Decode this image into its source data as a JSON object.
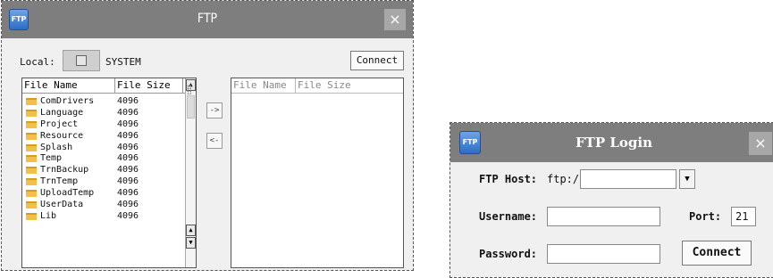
{
  "ftp_window": {
    "icon_text": "FTP",
    "title": "FTP",
    "close_glyph": "×",
    "local_label": "Local:",
    "local_path": "SYSTEM",
    "connect_label": "Connect",
    "copy_to_remote_label": "->",
    "copy_to_local_label": "<-",
    "local_list": {
      "columns": [
        "File Name",
        "File Size"
      ],
      "rows": [
        {
          "name": "ComDrivers",
          "size": "4096"
        },
        {
          "name": "Language",
          "size": "4096"
        },
        {
          "name": "Project",
          "size": "4096"
        },
        {
          "name": "Resource",
          "size": "4096"
        },
        {
          "name": "Splash",
          "size": "4096"
        },
        {
          "name": "Temp",
          "size": "4096"
        },
        {
          "name": "TrnBackup",
          "size": "4096"
        },
        {
          "name": "TrnTemp",
          "size": "4096"
        },
        {
          "name": "UploadTemp",
          "size": "4096"
        },
        {
          "name": "UserData",
          "size": "4096"
        },
        {
          "name": "Lib",
          "size": "4096"
        }
      ]
    },
    "remote_list": {
      "columns": [
        "File Name",
        "File Size"
      ]
    }
  },
  "login_window": {
    "icon_text": "FTP",
    "title": "FTP Login",
    "close_glyph": "×",
    "host_label": "FTP Host:",
    "host_prefix": "ftp:/",
    "host_value": "",
    "username_label": "Username:",
    "username_value": "",
    "port_label": "Port:",
    "port_value": "21",
    "password_label": "Password:",
    "password_value": "",
    "connect_label": "Connect"
  }
}
